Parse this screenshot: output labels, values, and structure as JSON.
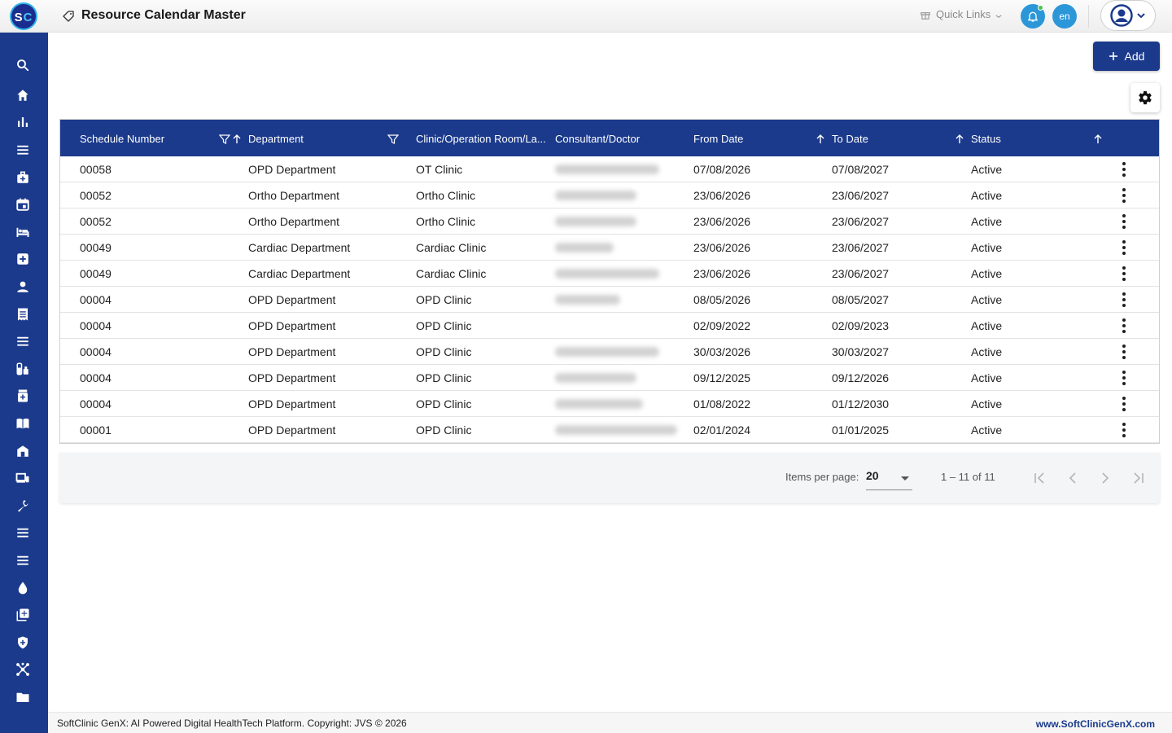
{
  "header": {
    "logo_text": "SC",
    "title": "Resource Calendar Master",
    "quick_links_label": "Quick Links",
    "language": "en"
  },
  "sidebar": {
    "items": [
      {
        "icon": "search-icon"
      },
      {
        "icon": "home-icon"
      },
      {
        "icon": "bar-chart-icon"
      },
      {
        "icon": "menu-icon"
      },
      {
        "icon": "medical-bag-icon"
      },
      {
        "icon": "calendar-icon"
      },
      {
        "icon": "bed-icon"
      },
      {
        "icon": "medical-plus-icon"
      },
      {
        "icon": "person-icon"
      },
      {
        "icon": "receipt-icon"
      },
      {
        "icon": "list-icon"
      },
      {
        "icon": "lab-icon"
      },
      {
        "icon": "pharmacy-icon"
      },
      {
        "icon": "book-icon"
      },
      {
        "icon": "store-icon"
      },
      {
        "icon": "devices-icon"
      },
      {
        "icon": "wrench-icon"
      },
      {
        "icon": "menu-icon-2"
      },
      {
        "icon": "menu-icon-3"
      },
      {
        "icon": "blood-drop-icon"
      },
      {
        "icon": "add-library-icon"
      },
      {
        "icon": "shield-icon"
      },
      {
        "icon": "network-icon"
      },
      {
        "icon": "folder-icon"
      }
    ]
  },
  "toolbar": {
    "add_label": "Add"
  },
  "table": {
    "columns": [
      "Schedule Number",
      "Department",
      "Clinic/Operation Room/La...",
      "Consultant/Doctor",
      "From Date",
      "To Date",
      "Status"
    ],
    "rows": [
      {
        "schedule": "00058",
        "department": "OPD Department",
        "clinic": "OT Clinic",
        "from": "07/08/2026",
        "to": "07/08/2027",
        "status": "Active"
      },
      {
        "schedule": "00052",
        "department": "Ortho Department",
        "clinic": "Ortho Clinic",
        "from": "23/06/2026",
        "to": "23/06/2027",
        "status": "Active"
      },
      {
        "schedule": "00052",
        "department": "Ortho Department",
        "clinic": "Ortho Clinic",
        "from": "23/06/2026",
        "to": "23/06/2027",
        "status": "Active"
      },
      {
        "schedule": "00049",
        "department": "Cardiac Department",
        "clinic": "Cardiac Clinic",
        "from": "23/06/2026",
        "to": "23/06/2027",
        "status": "Active"
      },
      {
        "schedule": "00049",
        "department": "Cardiac Department",
        "clinic": "Cardiac Clinic",
        "from": "23/06/2026",
        "to": "23/06/2027",
        "status": "Active"
      },
      {
        "schedule": "00004",
        "department": "OPD Department",
        "clinic": "OPD Clinic",
        "from": "08/05/2026",
        "to": "08/05/2027",
        "status": "Active"
      },
      {
        "schedule": "00004",
        "department": "OPD Department",
        "clinic": "OPD Clinic",
        "from": "02/09/2022",
        "to": "02/09/2023",
        "status": "Active"
      },
      {
        "schedule": "00004",
        "department": "OPD Department",
        "clinic": "OPD Clinic",
        "from": "30/03/2026",
        "to": "30/03/2027",
        "status": "Active"
      },
      {
        "schedule": "00004",
        "department": "OPD Department",
        "clinic": "OPD Clinic",
        "from": "09/12/2025",
        "to": "09/12/2026",
        "status": "Active"
      },
      {
        "schedule": "00004",
        "department": "OPD Department",
        "clinic": "OPD Clinic",
        "from": "01/08/2022",
        "to": "01/12/2030",
        "status": "Active"
      },
      {
        "schedule": "00001",
        "department": "OPD Department",
        "clinic": "OPD Clinic",
        "from": "02/01/2024",
        "to": "01/01/2025",
        "status": "Active"
      }
    ]
  },
  "paginator": {
    "items_per_page_label": "Items per page:",
    "page_size": "20",
    "range_label": "1 – 11 of 11"
  },
  "footer": {
    "copyright": "SoftClinic GenX: AI Powered Digital HealthTech Platform. Copyright: JVS © 2026",
    "website": "www.SoftClinicGenX.com"
  },
  "colors": {
    "primary": "#1b3a8c",
    "accent": "#2c97d8"
  }
}
